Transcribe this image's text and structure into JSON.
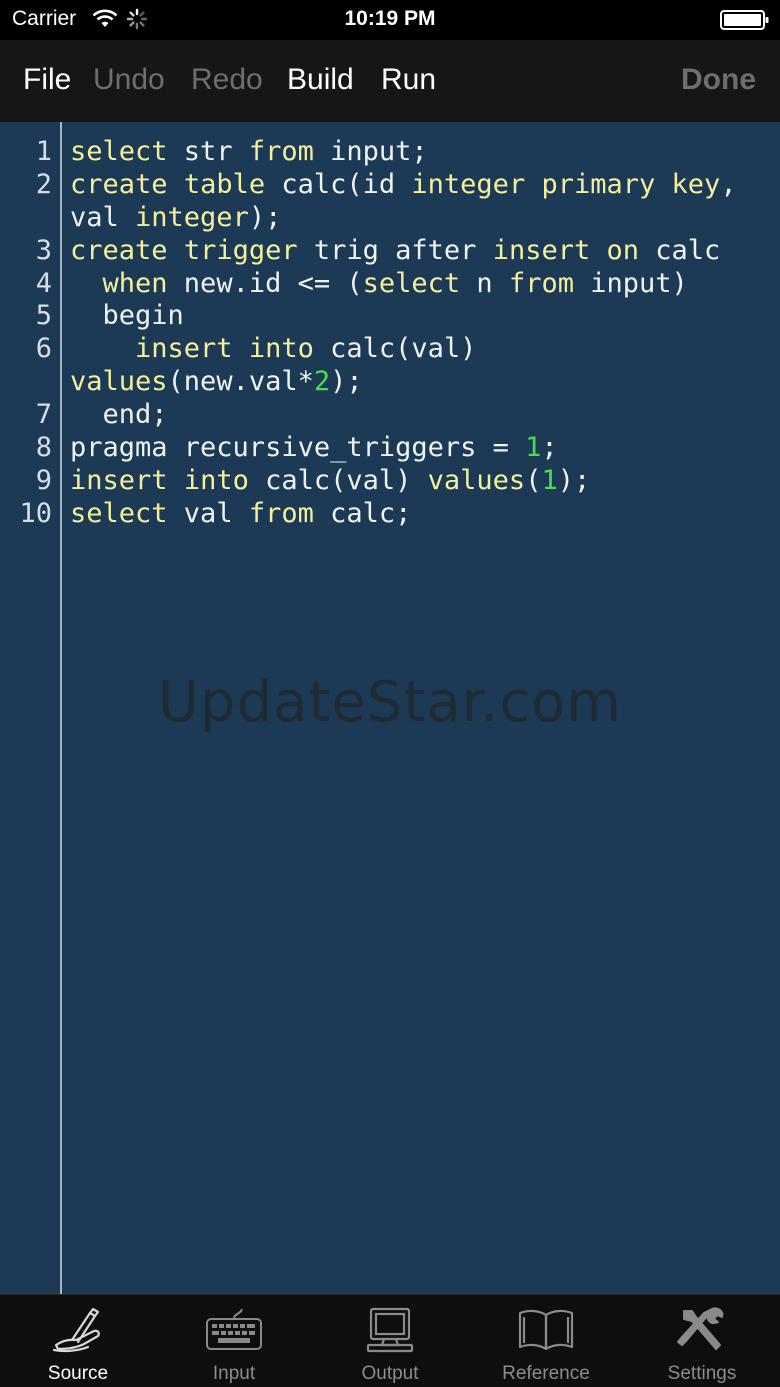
{
  "status_bar": {
    "carrier": "Carrier",
    "time": "10:19 PM",
    "icons": [
      "wifi-icon",
      "activity-spinner-icon",
      "battery-icon"
    ]
  },
  "toolbar": {
    "file": "File",
    "undo": "Undo",
    "redo": "Redo",
    "build": "Build",
    "run": "Run",
    "done": "Done"
  },
  "editor": {
    "colors": {
      "background": "#1c3a55",
      "keyword": "#f4ef9c",
      "number": "#46e04a",
      "text": "#f2f2f2"
    },
    "rows": [
      {
        "no": "1",
        "segments": [
          [
            "kw",
            "select"
          ],
          [
            "t",
            " str "
          ],
          [
            "kw",
            "from"
          ],
          [
            "t",
            " input;"
          ]
        ]
      },
      {
        "no": "2",
        "segments": [
          [
            "kw",
            "create"
          ],
          [
            "t",
            " "
          ],
          [
            "kw",
            "table"
          ],
          [
            "t",
            " calc(id "
          ],
          [
            "kw",
            "integer"
          ],
          [
            "t",
            " "
          ],
          [
            "kw",
            "primary"
          ],
          [
            "t",
            " "
          ],
          [
            "kw",
            "key"
          ],
          [
            "t",
            ","
          ]
        ]
      },
      {
        "no": "",
        "segments": [
          [
            "t",
            "val "
          ],
          [
            "kw",
            "integer"
          ],
          [
            "t",
            ");"
          ]
        ]
      },
      {
        "no": "3",
        "segments": [
          [
            "kw",
            "create"
          ],
          [
            "t",
            " "
          ],
          [
            "kw",
            "trigger"
          ],
          [
            "t",
            " trig after "
          ],
          [
            "kw",
            "insert"
          ],
          [
            "t",
            " "
          ],
          [
            "kw",
            "on"
          ],
          [
            "t",
            " calc"
          ]
        ]
      },
      {
        "no": "4",
        "segments": [
          [
            "t",
            "  "
          ],
          [
            "kw",
            "when"
          ],
          [
            "t",
            " new.id <= ("
          ],
          [
            "kw",
            "select"
          ],
          [
            "t",
            " n "
          ],
          [
            "kw",
            "from"
          ],
          [
            "t",
            " input)"
          ]
        ]
      },
      {
        "no": "5",
        "segments": [
          [
            "t",
            "  begin"
          ]
        ]
      },
      {
        "no": "6",
        "segments": [
          [
            "t",
            "    "
          ],
          [
            "kw",
            "insert"
          ],
          [
            "t",
            " "
          ],
          [
            "kw",
            "into"
          ],
          [
            "t",
            " calc(val)"
          ]
        ]
      },
      {
        "no": "",
        "segments": [
          [
            "kw",
            "values"
          ],
          [
            "t",
            "(new.val*"
          ],
          [
            "num",
            "2"
          ],
          [
            "t",
            ");"
          ]
        ]
      },
      {
        "no": "7",
        "segments": [
          [
            "t",
            "  end;"
          ]
        ]
      },
      {
        "no": "8",
        "segments": [
          [
            "t",
            "pragma recursive_triggers = "
          ],
          [
            "num",
            "1"
          ],
          [
            "t",
            ";"
          ]
        ]
      },
      {
        "no": "9",
        "segments": [
          [
            "kw",
            "insert"
          ],
          [
            "t",
            " "
          ],
          [
            "kw",
            "into"
          ],
          [
            "t",
            " calc(val) "
          ],
          [
            "kw",
            "values"
          ],
          [
            "t",
            "("
          ],
          [
            "num",
            "1"
          ],
          [
            "t",
            ");"
          ]
        ]
      },
      {
        "no": "10",
        "segments": [
          [
            "kw",
            "select"
          ],
          [
            "t",
            " val "
          ],
          [
            "kw",
            "from"
          ],
          [
            "t",
            " calc;"
          ]
        ]
      }
    ],
    "watermark": "UpdateStar.com"
  },
  "tab_bar": {
    "tabs": [
      {
        "label": "Source",
        "icon": "pen-hand-icon",
        "active": true
      },
      {
        "label": "Input",
        "icon": "keyboard-icon",
        "active": false
      },
      {
        "label": "Output",
        "icon": "computer-monitor-icon",
        "active": false
      },
      {
        "label": "Reference",
        "icon": "open-book-icon",
        "active": false
      },
      {
        "label": "Settings",
        "icon": "tools-icon",
        "active": false
      }
    ]
  }
}
